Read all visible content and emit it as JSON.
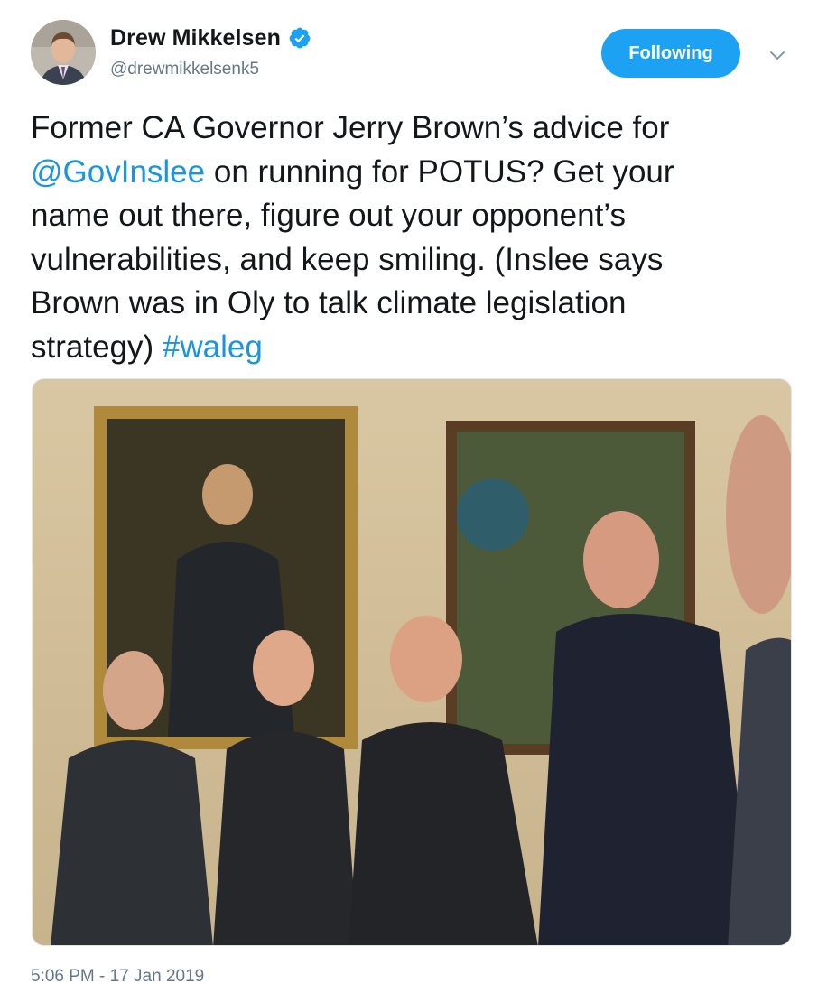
{
  "author": {
    "display_name": "Drew Mikkelsen",
    "handle": "@drewmikkelsenk5",
    "verified": true
  },
  "follow_button": {
    "label": "Following",
    "color": "#1da1f2"
  },
  "tweet": {
    "lines": [
      [
        {
          "text": "Former CA Governor Jerry Brown’s advice for",
          "link": false
        }
      ],
      [
        {
          "text": "@GovInslee",
          "link": true
        },
        {
          "text": " on running for POTUS? Get your",
          "link": false
        }
      ],
      [
        {
          "text": "name out there, figure out your opponent’s",
          "link": false
        }
      ],
      [
        {
          "text": "vulnerabilities, and keep smiling. (Inslee says",
          "link": false
        }
      ],
      [
        {
          "text": "Brown was in Oly to talk climate legislation",
          "link": false
        }
      ],
      [
        {
          "text": "strategy) ",
          "link": false
        },
        {
          "text": "#waleg",
          "link": true
        }
      ]
    ],
    "link_color": "#1b95e0",
    "timestamp": "5:06 PM - 17 Jan 2019"
  },
  "icons": {
    "verified": "verified-badge-icon",
    "more": "chevron-down-icon"
  }
}
